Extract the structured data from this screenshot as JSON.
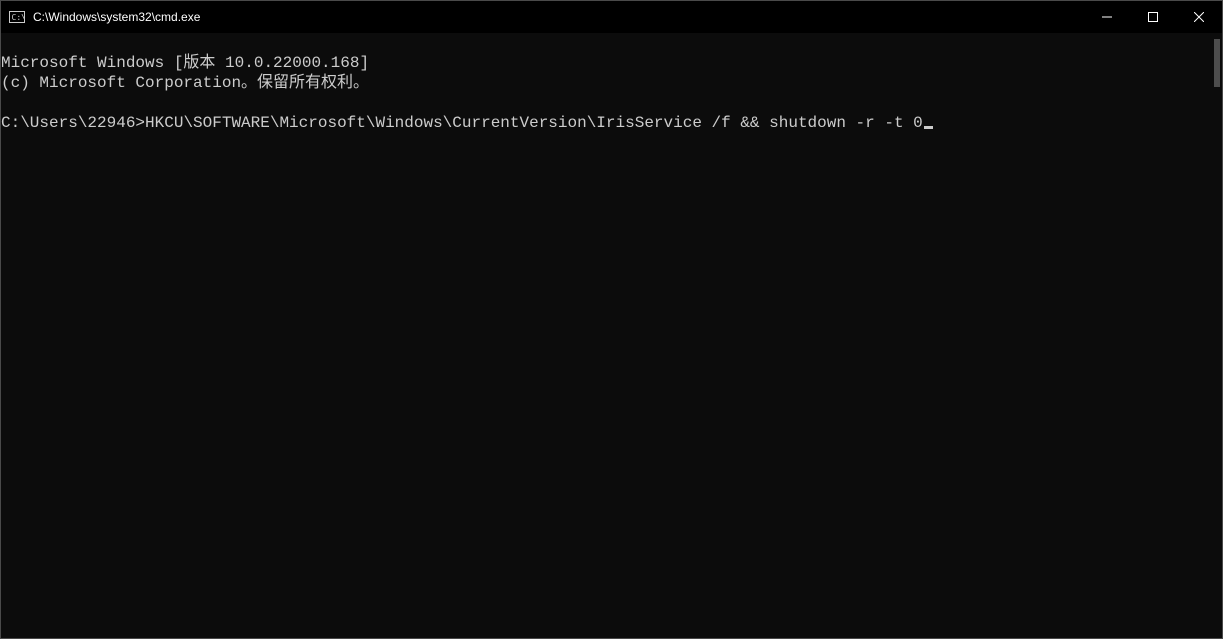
{
  "titlebar": {
    "title": "C:\\Windows\\system32\\cmd.exe",
    "icon_name": "cmd-icon",
    "minimize_label": "Minimize",
    "maximize_label": "Maximize",
    "close_label": "Close"
  },
  "terminal": {
    "line1": "Microsoft Windows [版本 10.0.22000.168]",
    "line2": "(c) Microsoft Corporation。保留所有权利。",
    "blank": "",
    "prompt": "C:\\Users\\22946>",
    "command": "HKCU\\SOFTWARE\\Microsoft\\Windows\\CurrentVersion\\IrisService /f && shutdown -r -t 0"
  }
}
